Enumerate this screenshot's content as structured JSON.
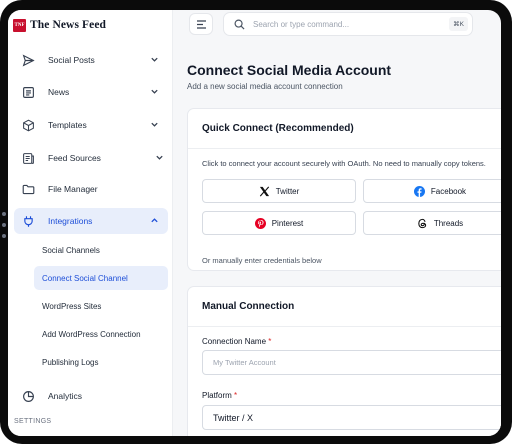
{
  "brand": {
    "mark": "TNF",
    "name": "The News Feed"
  },
  "sidebar": {
    "items": [
      {
        "label": "Social Posts",
        "icon": "send-icon"
      },
      {
        "label": "News",
        "icon": "newspaper-icon"
      },
      {
        "label": "Templates",
        "icon": "box-icon"
      },
      {
        "label": "Feed Sources",
        "icon": "feed-icon"
      },
      {
        "label": "File Manager",
        "icon": "folder-icon"
      },
      {
        "label": "Integrations",
        "icon": "plug-icon"
      },
      {
        "label": "Analytics",
        "icon": "pie-chart-icon"
      }
    ],
    "sub_items": [
      {
        "label": "Social Channels"
      },
      {
        "label": "Connect Social Channel"
      },
      {
        "label": "WordPress Sites"
      },
      {
        "label": "Add WordPress Connection"
      },
      {
        "label": "Publishing Logs"
      }
    ],
    "section_label": "SETTINGS"
  },
  "topbar": {
    "search_placeholder": "Search or type command...",
    "shortcut": "⌘K"
  },
  "page": {
    "title": "Connect Social Media Account",
    "subtitle": "Add a new social media account connection"
  },
  "quick_connect": {
    "title": "Quick Connect (Recommended)",
    "description": "Click to connect your account securely with OAuth. No need to manually copy tokens.",
    "buttons": [
      {
        "label": "Twitter",
        "icon": "x-logo-icon"
      },
      {
        "label": "Facebook",
        "icon": "facebook-icon"
      },
      {
        "label": "Pinterest",
        "icon": "pinterest-icon"
      },
      {
        "label": "Threads",
        "icon": "threads-icon"
      }
    ],
    "or_text": "Or manually enter credentials below"
  },
  "manual": {
    "title": "Manual Connection",
    "connection_name_label": "Connection Name",
    "connection_name_placeholder": "My Twitter Account",
    "platform_label": "Platform",
    "platform_value": "Twitter / X",
    "required_mark": "*"
  },
  "colors": {
    "brand_red": "#c8102e",
    "accent_blue": "#1d4ed8",
    "active_bg": "#e8eefb",
    "facebook": "#1877f2",
    "pinterest": "#e60023"
  }
}
